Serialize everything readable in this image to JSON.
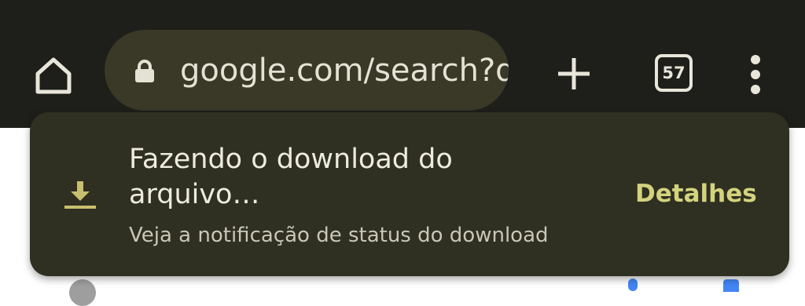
{
  "toolbar": {
    "url_text": "google.com/search?q",
    "tab_count": "57",
    "icons": {
      "home": "home-icon",
      "lock": "lock-icon",
      "new_tab": "plus-icon",
      "tab_switcher": "tab-switcher-icon",
      "menu": "more-vert-icon"
    }
  },
  "snackbar": {
    "title": "Fazendo o download do arquivo…",
    "subtitle": "Veja a notificação de status do download",
    "action_label": "Detalhes",
    "icon": "download-icon"
  },
  "colors": {
    "toolbar_bg": "#1e1e1a",
    "omnibox_bg": "#3a3928",
    "snackbar_bg": "#2f2f22",
    "accent": "#d3d37e",
    "download_icon": "#c8c06e"
  }
}
